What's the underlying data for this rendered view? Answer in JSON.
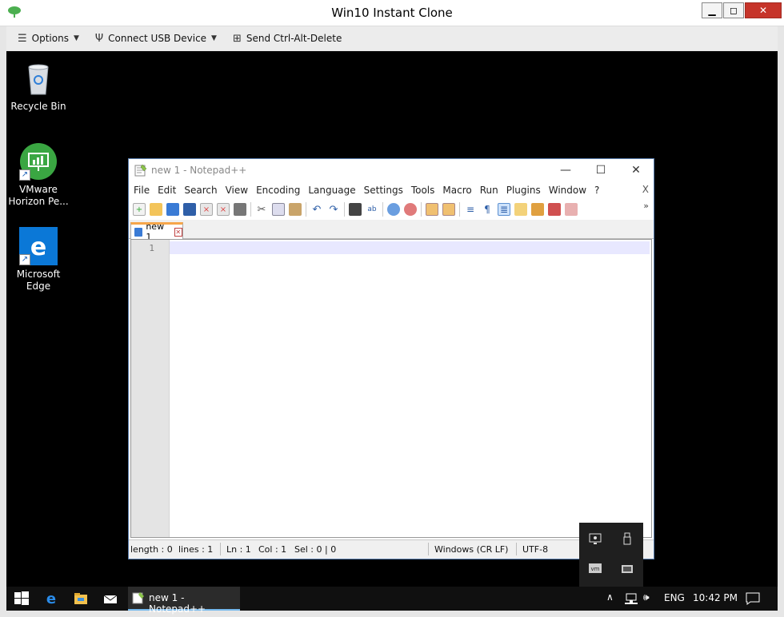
{
  "outer_window": {
    "title": "Win10 Instant Clone",
    "controls": {
      "minimize": "▁",
      "maximize": "◻",
      "close": "✕"
    }
  },
  "outer_toolbar": {
    "options_label": "Options",
    "usb_label": "Connect USB Device",
    "ctrlaltdel_label": "Send Ctrl-Alt-Delete"
  },
  "desktop_icons": [
    {
      "label": "Recycle Bin"
    },
    {
      "label": "VMware\nHorizon Pe..."
    },
    {
      "label": "Microsoft\nEdge"
    }
  ],
  "notepad": {
    "title": "new 1 - Notepad++",
    "menu": [
      "File",
      "Edit",
      "Search",
      "View",
      "Encoding",
      "Language",
      "Settings",
      "Tools",
      "Macro",
      "Run",
      "Plugins",
      "Window",
      "?"
    ],
    "menu_close": "X",
    "toolbar_overflow": "»",
    "tab_label": "new 1",
    "line_number": "1",
    "status": {
      "length": "length : 0",
      "lines": "lines : 1",
      "ln": "Ln : 1",
      "col": "Col : 1",
      "sel": "Sel : 0 | 0",
      "eol": "Windows (CR LF)",
      "encoding": "UTF-8"
    }
  },
  "taskbar": {
    "app_label": "new 1 - Notepad++",
    "language": "ENG",
    "time": "10:42 PM"
  },
  "colors": {
    "desktop_bg": "#000000",
    "close_red": "#c6342a",
    "tab_accent": "#f6a64a",
    "current_line": "#e8e8ff",
    "taskbar_active": "#76b9ed"
  }
}
